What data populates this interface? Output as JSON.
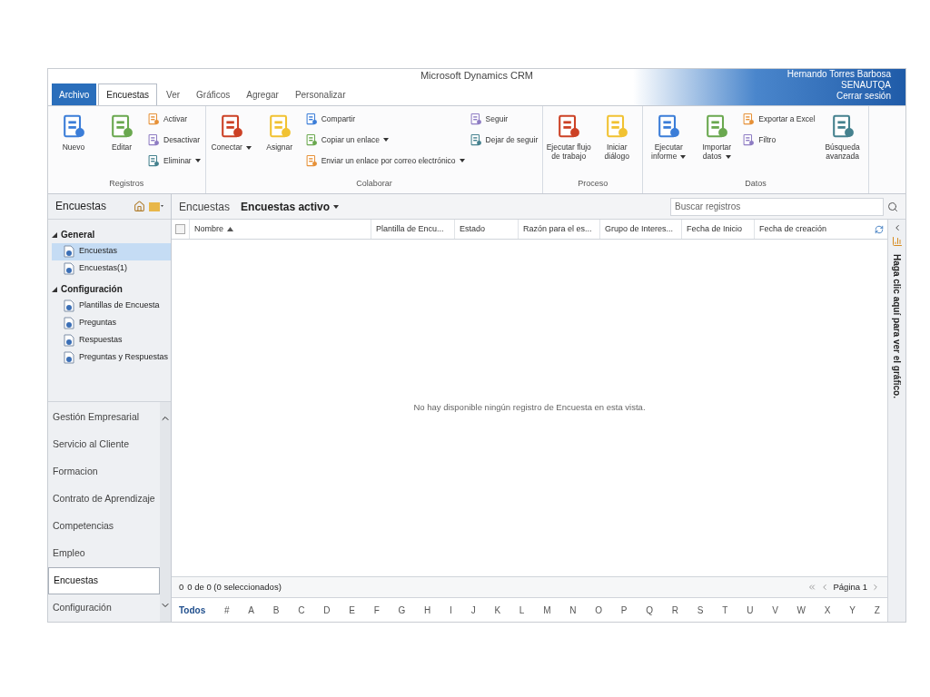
{
  "app_title": "Microsoft Dynamics CRM",
  "user": {
    "name": "Hernando Torres Barbosa",
    "org": "SENAUTQA",
    "signout": "Cerrar sesión"
  },
  "tabs": [
    {
      "label": "Archivo",
      "kind": "file",
      "selected": false
    },
    {
      "label": "Encuestas",
      "kind": "tab",
      "selected": true
    },
    {
      "label": "Ver",
      "kind": "tab",
      "selected": false
    },
    {
      "label": "Gráficos",
      "kind": "tab",
      "selected": false
    },
    {
      "label": "Agregar",
      "kind": "tab",
      "selected": false
    },
    {
      "label": "Personalizar",
      "kind": "tab",
      "selected": false
    }
  ],
  "ribbon": [
    {
      "label": "Registros",
      "columns": [
        [
          {
            "label": "Nuevo",
            "kind": "large",
            "dropdown": false
          }
        ],
        [
          {
            "label": "Editar",
            "kind": "large",
            "dropdown": false
          }
        ],
        [
          {
            "label": "Activar",
            "kind": "small",
            "dropdown": false
          },
          {
            "label": "Desactivar",
            "kind": "small",
            "dropdown": false
          },
          {
            "label": "Eliminar",
            "kind": "small",
            "dropdown": true
          }
        ]
      ]
    },
    {
      "label": "Colaborar",
      "columns": [
        [
          {
            "label": "Conectar",
            "kind": "large",
            "dropdown": true
          }
        ],
        [
          {
            "label": "Asignar",
            "kind": "large",
            "dropdown": false
          }
        ],
        [
          {
            "label": "Compartir",
            "kind": "small",
            "dropdown": false
          },
          {
            "label": "Copiar un enlace",
            "kind": "small",
            "dropdown": true
          },
          {
            "label": "Enviar un enlace por correo electrónico",
            "kind": "small",
            "dropdown": true
          }
        ],
        [
          {
            "label": "Seguir",
            "kind": "small",
            "dropdown": false
          },
          {
            "label": "Dejar de seguir",
            "kind": "small",
            "dropdown": false
          }
        ]
      ]
    },
    {
      "label": "Proceso",
      "columns": [
        [
          {
            "label": "Ejecutar flujo de trabajo",
            "kind": "large",
            "dropdown": false
          }
        ],
        [
          {
            "label": "Iniciar diálogo",
            "kind": "large",
            "dropdown": false
          }
        ]
      ]
    },
    {
      "label": "Datos",
      "columns": [
        [
          {
            "label": "Ejecutar informe",
            "kind": "large",
            "dropdown": true
          }
        ],
        [
          {
            "label": "Importar datos",
            "kind": "large",
            "dropdown": true
          }
        ],
        [
          {
            "label": "Exportar a Excel",
            "kind": "small",
            "dropdown": false
          },
          {
            "label": "Filtro",
            "kind": "small",
            "dropdown": false
          }
        ],
        [
          {
            "label": "Búsqueda avanzada",
            "kind": "large",
            "dropdown": false
          }
        ]
      ]
    }
  ],
  "nav": {
    "title": "Encuestas",
    "sections": [
      {
        "label": "General",
        "expanded": true,
        "items": [
          {
            "label": "Encuestas",
            "selected": true
          },
          {
            "label": "Encuestas(1)",
            "selected": false
          }
        ]
      },
      {
        "label": "Configuración",
        "expanded": true,
        "items": [
          {
            "label": "Plantillas de Encuesta",
            "selected": false
          },
          {
            "label": "Preguntas",
            "selected": false
          },
          {
            "label": "Respuestas",
            "selected": false
          },
          {
            "label": "Preguntas y Respuestas",
            "selected": false
          }
        ]
      }
    ],
    "areas": [
      {
        "label": "Gestión Empresarial",
        "selected": false
      },
      {
        "label": "Servicio al Cliente",
        "selected": false
      },
      {
        "label": "Formacion",
        "selected": false
      },
      {
        "label": "Contrato de Aprendizaje",
        "selected": false
      },
      {
        "label": "Competencias",
        "selected": false
      },
      {
        "label": "Empleo",
        "selected": false
      },
      {
        "label": "Encuestas",
        "selected": true
      },
      {
        "label": "Configuración",
        "selected": false
      }
    ]
  },
  "grid": {
    "entity": "Encuestas",
    "view": "Encuestas activo",
    "search": {
      "placeholder": "Buscar registros"
    },
    "select_all_checked": false,
    "columns": [
      {
        "label": "Nombre",
        "sorted": true
      },
      {
        "label": "Plantilla de Encu...",
        "sorted": false
      },
      {
        "label": "Estado",
        "sorted": false
      },
      {
        "label": "Razón para el es...",
        "sorted": false
      },
      {
        "label": "Grupo de Interes...",
        "sorted": false
      },
      {
        "label": "Fecha de Inicio",
        "sorted": false
      },
      {
        "label": "Fecha de creación",
        "sorted": false
      }
    ],
    "empty_message": "No hay disponible ningún registro de Encuesta en esta vista.",
    "footer_count": "0",
    "footer_status": "0 de 0 (0 seleccionados)",
    "page": "Página 1",
    "letters": [
      {
        "label": "Todos",
        "selected": true
      },
      {
        "label": "#",
        "selected": false
      },
      {
        "label": "A",
        "selected": false
      },
      {
        "label": "B",
        "selected": false
      },
      {
        "label": "C",
        "selected": false
      },
      {
        "label": "D",
        "selected": false
      },
      {
        "label": "E",
        "selected": false
      },
      {
        "label": "F",
        "selected": false
      },
      {
        "label": "G",
        "selected": false
      },
      {
        "label": "H",
        "selected": false
      },
      {
        "label": "I",
        "selected": false
      },
      {
        "label": "J",
        "selected": false
      },
      {
        "label": "K",
        "selected": false
      },
      {
        "label": "L",
        "selected": false
      },
      {
        "label": "M",
        "selected": false
      },
      {
        "label": "N",
        "selected": false
      },
      {
        "label": "O",
        "selected": false
      },
      {
        "label": "P",
        "selected": false
      },
      {
        "label": "Q",
        "selected": false
      },
      {
        "label": "R",
        "selected": false
      },
      {
        "label": "S",
        "selected": false
      },
      {
        "label": "T",
        "selected": false
      },
      {
        "label": "U",
        "selected": false
      },
      {
        "label": "V",
        "selected": false
      },
      {
        "label": "W",
        "selected": false
      },
      {
        "label": "X",
        "selected": false
      },
      {
        "label": "Y",
        "selected": false
      },
      {
        "label": "Z",
        "selected": false
      }
    ]
  },
  "chart_panel": {
    "label": "Haga clic aquí para ver el gráfico."
  }
}
